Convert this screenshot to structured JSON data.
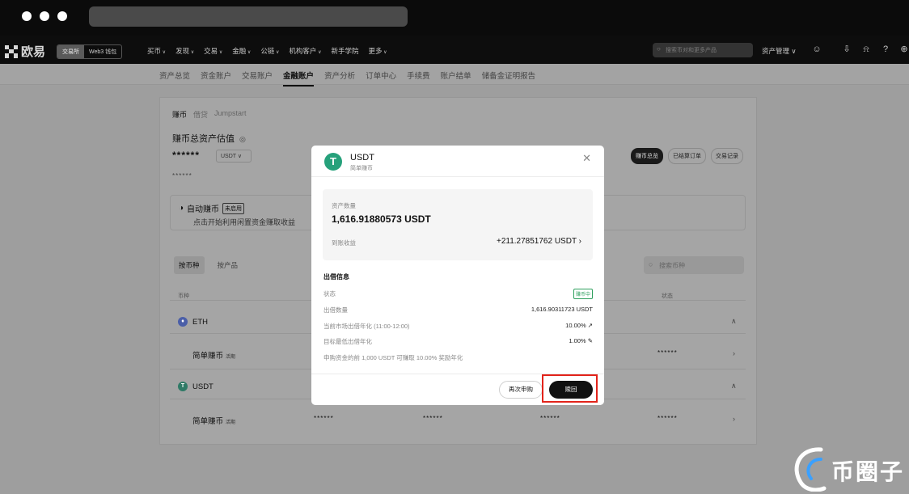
{
  "brand": {
    "name": "欧易"
  },
  "header": {
    "seg_exchange": "交易所",
    "seg_web3": "Web3 钱包",
    "menu": [
      "买币",
      "发现",
      "交易",
      "金融",
      "公链",
      "机构客户",
      "新手学院",
      "更多"
    ],
    "search_placeholder": "搜索币对和更多产品",
    "asset_mgmt": "资产管理"
  },
  "subnav": {
    "items": [
      "资产总览",
      "资金账户",
      "交易账户",
      "金融账户",
      "资产分析",
      "订单中心",
      "手续费",
      "账户结单",
      "储备金证明报告"
    ],
    "active_index": 3
  },
  "earn": {
    "tabs": [
      "赚币",
      "借贷",
      "Jumpstart"
    ],
    "total_title": "赚币总资产估值",
    "masked_total": "******",
    "unit": "USDT",
    "masked_small": "******",
    "pills": [
      "赚币总览",
      "已结算订单",
      "交易记录"
    ],
    "auto_title": "自动赚币",
    "auto_badge": "未启用",
    "auto_desc": "点击开始利用闲置资金赚取收益",
    "view_tabs": [
      "按币种",
      "按产品"
    ],
    "coin_search_placeholder": "搜索币种",
    "col_coin": "币种",
    "col_status": "状态",
    "rows": [
      {
        "coin": "ETH",
        "product": "简单赚币",
        "tag": "活期",
        "masked": "******"
      },
      {
        "coin": "USDT",
        "product": "简单赚币",
        "tag": "活期",
        "masked": [
          "******",
          "******",
          "******",
          "******"
        ]
      }
    ]
  },
  "modal": {
    "title": "USDT",
    "subtitle": "简单赚币",
    "amount_label": "资产数量",
    "amount": "1,616.91880573 USDT",
    "earnings_label": "到账收益",
    "earnings": "+211.27851762 USDT",
    "section": "出借信息",
    "status_label": "状态",
    "status_value": "赚币中",
    "lend_amount_label": "出借数量",
    "lend_amount": "1,616.90311723 USDT",
    "market_rate_label": "当前市场出借年化 (11:00-12:00)",
    "market_rate": "10.00%",
    "min_rate_label": "目标最低出借年化",
    "min_rate": "1.00%",
    "note": "申购资金的前 1,000 USDT 可赚取 10.00% 奖励年化",
    "btn_again": "再次申购",
    "btn_redeem": "赎回"
  },
  "watermark": {
    "text": "币圈子"
  }
}
